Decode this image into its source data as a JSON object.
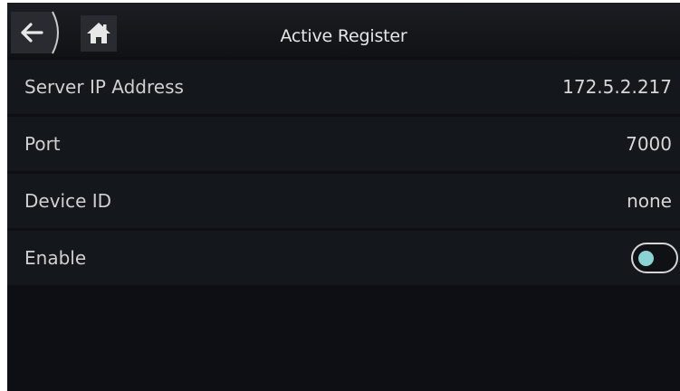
{
  "header": {
    "title": "Active Register",
    "back_icon": "arrow-left-icon",
    "home_icon": "home-icon"
  },
  "rows": [
    {
      "label": "Server IP Address",
      "value": "172.5.2.217"
    },
    {
      "label": "Port",
      "value": "7000"
    },
    {
      "label": "Device ID",
      "value": "none"
    },
    {
      "label": "Enable",
      "toggle_on": false
    }
  ],
  "colors": {
    "background": "#0d0f14",
    "row_background": "#14171c",
    "toggle_knob": "#8ad3d3",
    "text": "#cfd0d2"
  }
}
